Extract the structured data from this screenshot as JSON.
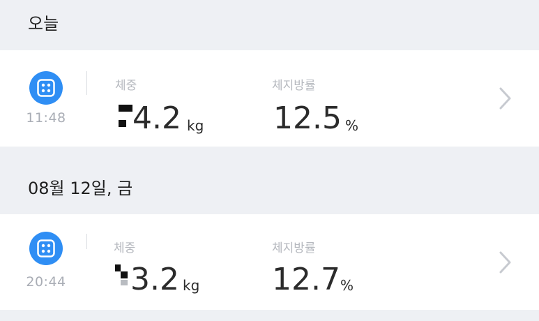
{
  "sections": [
    {
      "header": "오늘",
      "entry": {
        "time": "11:48",
        "weight_label": "체중",
        "weight_value": "4.2",
        "weight_unit": "kg",
        "fat_label": "체지방률",
        "fat_value": "12.5",
        "fat_unit": "%"
      }
    },
    {
      "header": "08월 12일, 금",
      "entry": {
        "time": "20:44",
        "weight_label": "체중",
        "weight_value": "3.2",
        "weight_unit": "kg",
        "fat_label": "체지방률",
        "fat_value": "12.7",
        "fat_unit": "%"
      }
    }
  ],
  "colors": {
    "accent": "#2f8ef4",
    "background": "#eef0f4",
    "card": "#ffffff",
    "muted_text": "#b6b9bf",
    "primary_text": "#2b2b2b"
  },
  "icons": {
    "scale": "scale-icon",
    "chevron": "chevron-right-icon"
  }
}
